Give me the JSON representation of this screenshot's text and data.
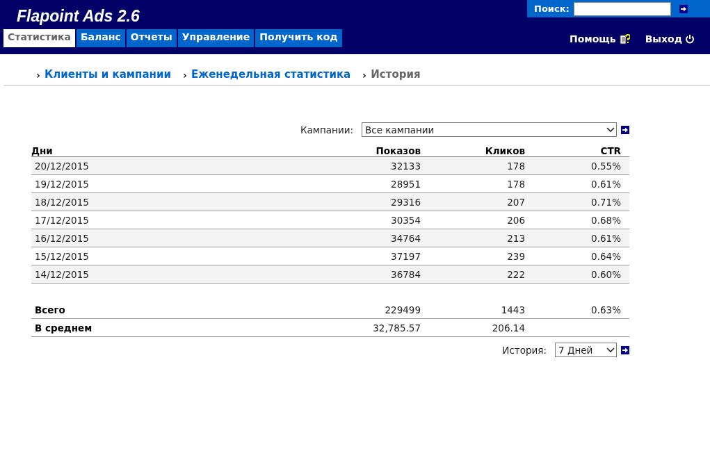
{
  "app_title": "Flapoint Ads 2.6",
  "search": {
    "label": "Поиск:"
  },
  "tabs": [
    {
      "label": "Статистика",
      "selected": true
    },
    {
      "label": "Баланс",
      "selected": false
    },
    {
      "label": "Отчеты",
      "selected": false
    },
    {
      "label": "Управление",
      "selected": false
    },
    {
      "label": "Получить код",
      "selected": false
    }
  ],
  "header_links": [
    {
      "label": "Помощь",
      "kind": "help"
    },
    {
      "label": "Выход",
      "kind": "logout"
    }
  ],
  "breadcrumbs": [
    {
      "label": "Клиенты и кампании",
      "selected": false
    },
    {
      "label": "Еженедельная статистика",
      "selected": false
    },
    {
      "label": "История",
      "selected": true
    }
  ],
  "campaign_filter": {
    "label": "Кампании:",
    "value": "Все кампании"
  },
  "table": {
    "columns": [
      "Дни",
      "Показов",
      "Кликов",
      "CTR"
    ],
    "rows": [
      [
        "20/12/2015",
        "32133",
        "178",
        "0.55%"
      ],
      [
        "19/12/2015",
        "28951",
        "178",
        "0.61%"
      ],
      [
        "18/12/2015",
        "29316",
        "207",
        "0.71%"
      ],
      [
        "17/12/2015",
        "30354",
        "206",
        "0.68%"
      ],
      [
        "16/12/2015",
        "34764",
        "213",
        "0.61%"
      ],
      [
        "15/12/2015",
        "37197",
        "239",
        "0.64%"
      ],
      [
        "14/12/2015",
        "36784",
        "222",
        "0.60%"
      ]
    ],
    "totals": [
      [
        "Всего",
        "229499",
        "1443",
        "0.63%"
      ],
      [
        "В среднем",
        "32,785.57",
        "206.14"
      ]
    ]
  },
  "history_filter": {
    "label": "История:",
    "value": "7 Дней"
  }
}
